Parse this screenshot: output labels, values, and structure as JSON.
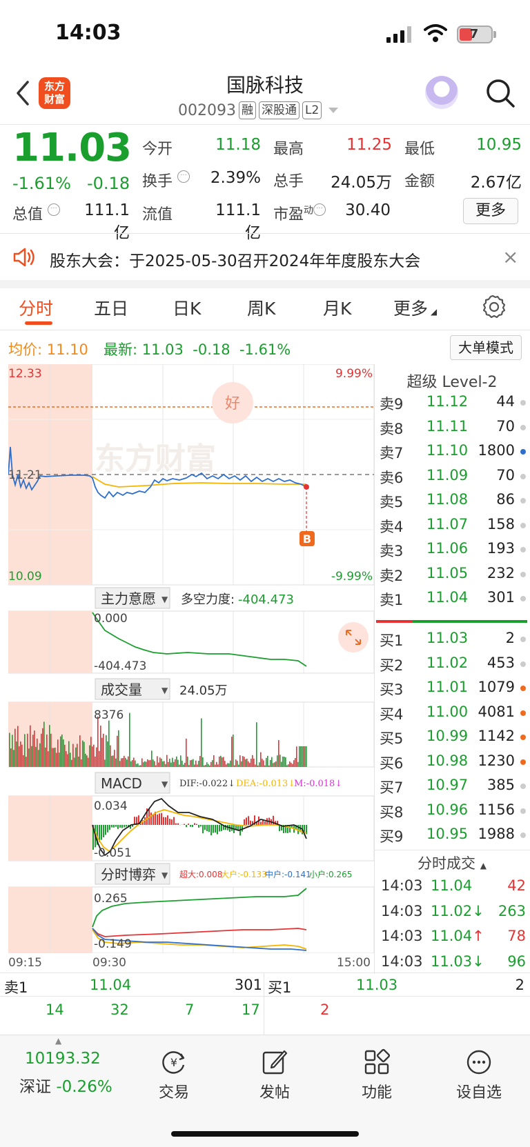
{
  "status_bar": {
    "time": "14:03",
    "battery": "7"
  },
  "header": {
    "logo_text": "东方财富",
    "stock_name": "国脉科技",
    "stock_code": "002093",
    "tags": [
      "融",
      "深股通",
      "L2"
    ]
  },
  "quote": {
    "price": "11.03",
    "change_pct": "-1.61%",
    "change_val": "-0.18",
    "fields": [
      {
        "label": "今开",
        "value": "11.18",
        "color": "green"
      },
      {
        "label": "最高",
        "value": "11.25",
        "color": "red"
      },
      {
        "label": "最低",
        "value": "10.95",
        "color": "green"
      },
      {
        "label": "换手",
        "value": "2.39%",
        "color": "dark"
      },
      {
        "label": "总手",
        "value": "24.05万",
        "color": "dark"
      },
      {
        "label": "金额",
        "value": "2.67亿",
        "color": "dark"
      },
      {
        "label": "总值",
        "value": "111.1亿",
        "color": "dark"
      },
      {
        "label": "流值",
        "value": "111.1亿",
        "color": "dark"
      },
      {
        "label": "市盈",
        "sup": "动",
        "value": "30.40",
        "color": "dark"
      }
    ],
    "more_label": "更多"
  },
  "notice": {
    "text": "股东大会：于2025-05-30召开2024年年度股东大会"
  },
  "tabs": [
    "分时",
    "五日",
    "日K",
    "周K",
    "月K",
    "更多"
  ],
  "price_line": {
    "avg_label": "均价:",
    "avg_value": "11.10",
    "latest_label": "最新:",
    "latest_value": "11.03",
    "change": "-0.18",
    "pct": "-1.61%",
    "big_order_btn": "大单模式"
  },
  "chart": {
    "price_high": "12.33",
    "price_low": "10.09",
    "pct_high": "9.99%",
    "pct_low": "-9.99%",
    "prev_close": "11.21",
    "hao_label": "好",
    "b_label": "B",
    "watermark": "东方财富",
    "panel1": {
      "name": "主力意愿",
      "metric_label": "多空力度:",
      "metric_value": "-404.473",
      "top": "0.000",
      "bottom": "-404.473"
    },
    "panel2": {
      "name": "成交量",
      "metric_value": "24.05万",
      "top": "8376"
    },
    "panel3": {
      "name": "MACD",
      "dif": "DIF:-0.022↓",
      "dea": "DEA:-0.013↓",
      "m": "M:-0.018↓",
      "top": "0.034",
      "bottom": "-0.051"
    },
    "panel4": {
      "name": "分时博弈",
      "legend_cd": "超大:0.008",
      "legend_dh": "大户:-0.133",
      "legend_zh": "中户:-0.141",
      "legend_xh": "小户:0.265",
      "top": "0.265",
      "bottom": "-0.149"
    },
    "time_labels": [
      "09:15",
      "09:30",
      "15:00"
    ]
  },
  "order_book": {
    "title": "超级 Level-2",
    "asks": [
      {
        "label": "卖9",
        "price": "11.12",
        "vol": "44",
        "dot": "#cccccc"
      },
      {
        "label": "卖8",
        "price": "11.11",
        "vol": "70",
        "dot": "#cccccc"
      },
      {
        "label": "卖7",
        "price": "11.10",
        "vol": "1800",
        "dot": "#2f6fcc"
      },
      {
        "label": "卖6",
        "price": "11.09",
        "vol": "70",
        "dot": "#cccccc"
      },
      {
        "label": "卖5",
        "price": "11.08",
        "vol": "86",
        "dot": "#cccccc"
      },
      {
        "label": "卖4",
        "price": "11.07",
        "vol": "158",
        "dot": "#cccccc"
      },
      {
        "label": "卖3",
        "price": "11.06",
        "vol": "193",
        "dot": "#cccccc"
      },
      {
        "label": "卖2",
        "price": "11.05",
        "vol": "232",
        "dot": "#cccccc"
      },
      {
        "label": "卖1",
        "price": "11.04",
        "vol": "301",
        "dot": "#cccccc"
      }
    ],
    "bids": [
      {
        "label": "买1",
        "price": "11.03",
        "vol": "2",
        "dot": "#cccccc"
      },
      {
        "label": "买2",
        "price": "11.02",
        "vol": "453",
        "dot": "#cccccc"
      },
      {
        "label": "买3",
        "price": "11.01",
        "vol": "1079",
        "dot": "#f06a1e"
      },
      {
        "label": "买4",
        "price": "11.00",
        "vol": "4081",
        "dot": "#f06a1e"
      },
      {
        "label": "买5",
        "price": "10.99",
        "vol": "1142",
        "dot": "#f06a1e"
      },
      {
        "label": "买6",
        "price": "10.98",
        "vol": "1230",
        "dot": "#f06a1e"
      },
      {
        "label": "买7",
        "price": "10.97",
        "vol": "385",
        "dot": "#cccccc"
      },
      {
        "label": "买8",
        "price": "10.96",
        "vol": "1156",
        "dot": "#cccccc"
      },
      {
        "label": "买9",
        "price": "10.95",
        "vol": "1988",
        "dot": "#cccccc"
      }
    ],
    "trades_title": "分时成交",
    "trades": [
      {
        "time": "14:03",
        "price": "11.04",
        "arrow": "",
        "vol": "42",
        "vol_color": "red"
      },
      {
        "time": "14:03",
        "price": "11.02",
        "arrow": "↓",
        "vol": "263",
        "vol_color": "green"
      },
      {
        "time": "14:03",
        "price": "11.04",
        "arrow": "↑",
        "vol": "78",
        "vol_color": "red"
      },
      {
        "time": "14:03",
        "price": "11.03",
        "arrow": "↓",
        "vol": "96",
        "vol_color": "green"
      }
    ]
  },
  "summary": {
    "sell_label": "卖1",
    "sell_price": "11.04",
    "sell_vol": "301",
    "buy_label": "买1",
    "buy_price": "11.03",
    "buy_vol": "2",
    "sell_queue": [
      "14",
      "32",
      "7",
      "17"
    ],
    "buy_queue": [
      "2"
    ]
  },
  "bottom_nav": {
    "index_value": "10193.32",
    "index_name": "深证",
    "index_pct": "-0.26%",
    "items": [
      "交易",
      "发帖",
      "功能",
      "设自选"
    ]
  }
}
